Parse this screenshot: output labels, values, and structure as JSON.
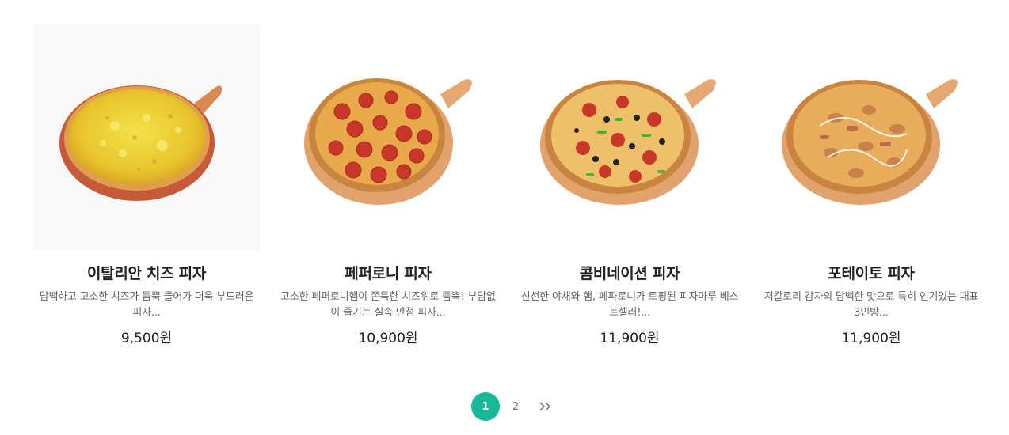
{
  "products": [
    {
      "title": "이탈리안 치즈 피자",
      "desc": "담백하고 고소한 치즈가 듬뿍 들어가 더욱 부드러운 피자...",
      "price": "9,500원",
      "image": "cheese-pizza-image"
    },
    {
      "title": "페퍼로니 피자",
      "desc": "고소한 페퍼로니햄이 쫀득한 치즈위로 뜸뿍! 부담없이 즐기는 실속 만점 피자...",
      "price": "10,900원",
      "image": "pepperoni-pizza-image"
    },
    {
      "title": "콤비네이션 피자",
      "desc": "신선한 야채와 햄, 페파로니가 토핑된 피자마루 베스트셀러!...",
      "price": "11,900원",
      "image": "combination-pizza-image"
    },
    {
      "title": "포테이토 피자",
      "desc": "저칼로리 감자의 담백한 맛으로 특히 인기있는 대표 3인방...",
      "price": "11,900원",
      "image": "potato-pizza-image"
    }
  ],
  "pagination": {
    "pages": [
      "1",
      "2"
    ],
    "current": "1",
    "next_icon": "double-chevron-right-icon"
  },
  "colors": {
    "accent": "#17b89a",
    "board": "#e2a26c",
    "crust": "#d9914a"
  }
}
